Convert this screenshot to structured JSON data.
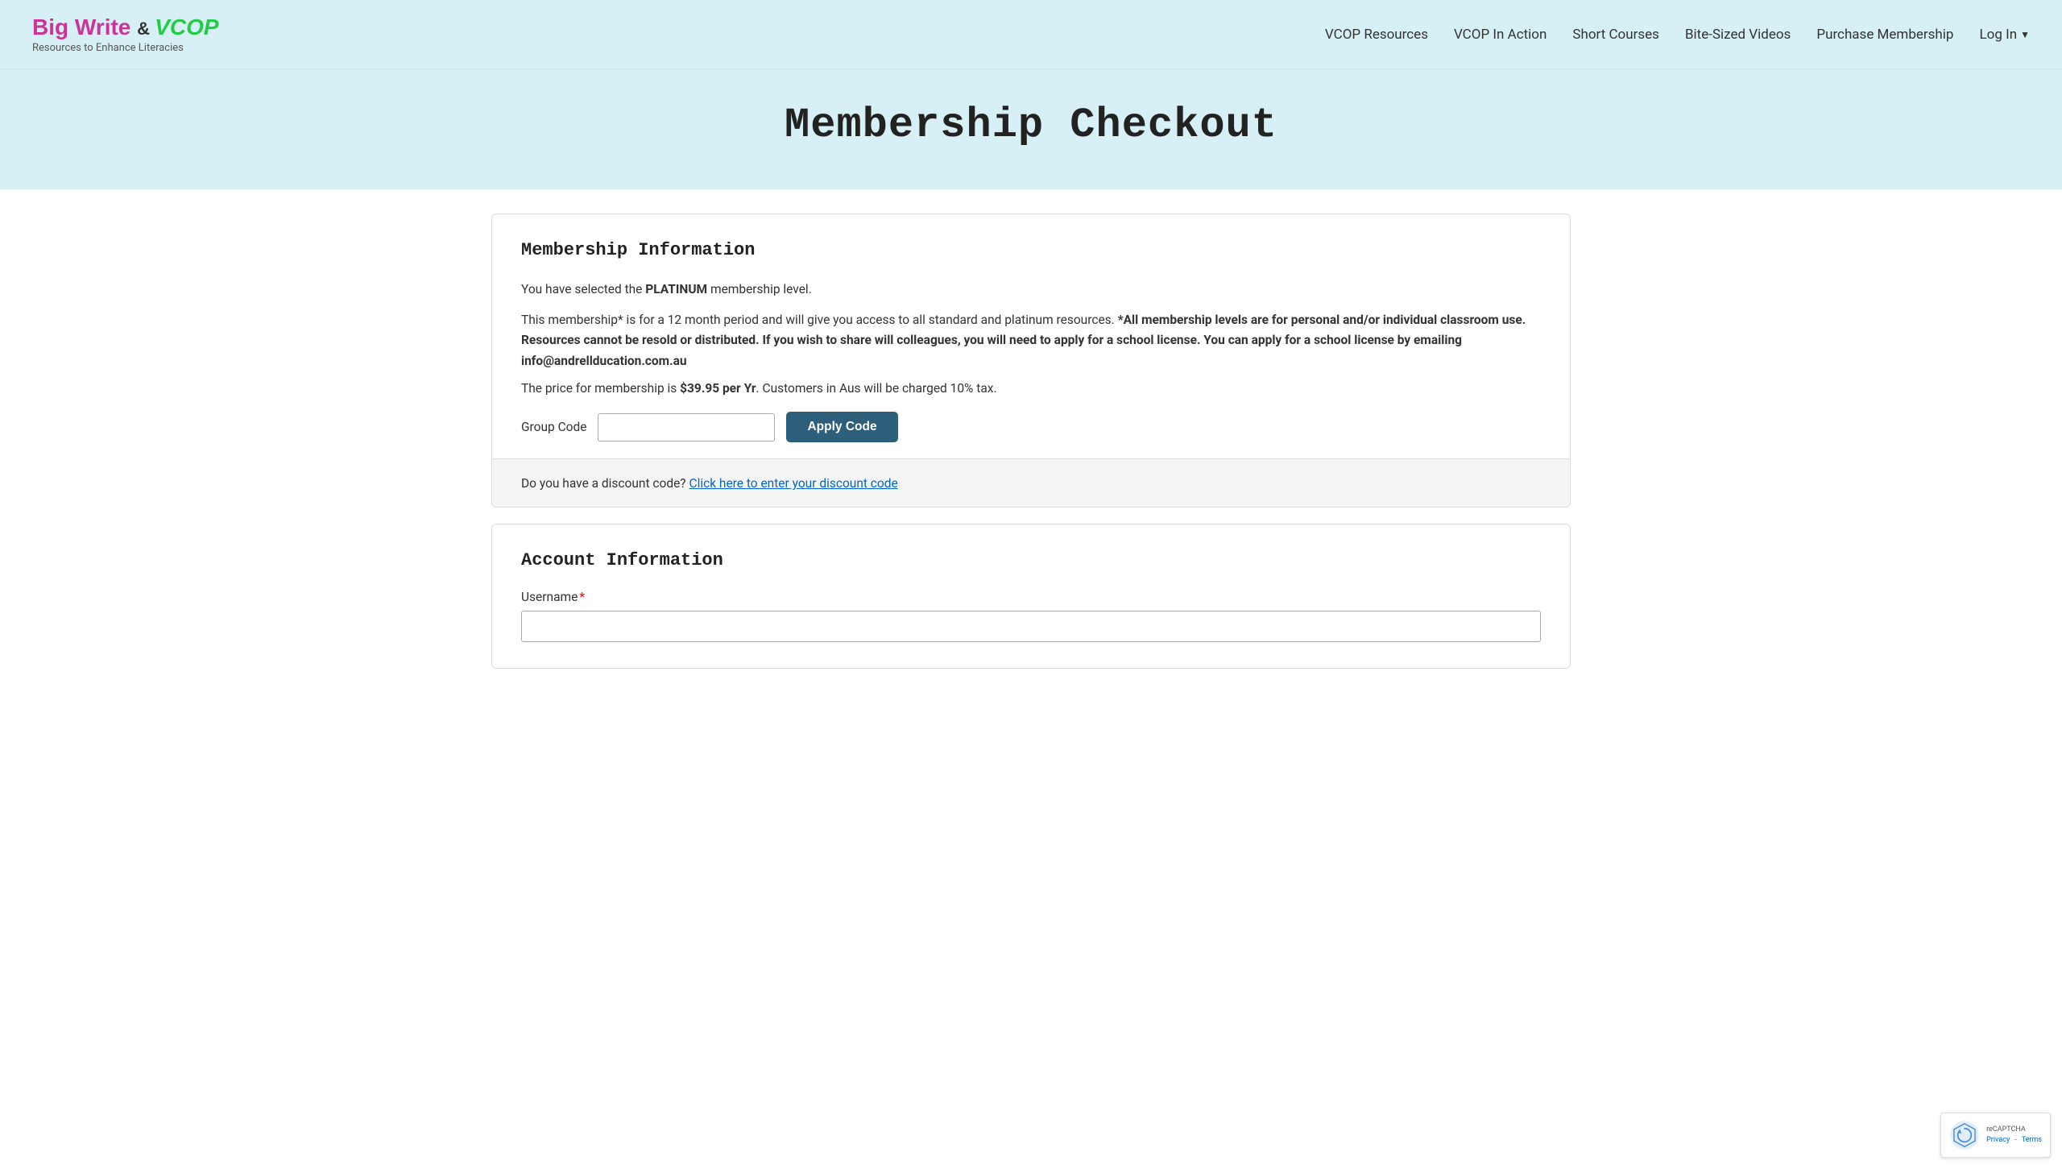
{
  "site": {
    "logo_big_write": "Big Write",
    "logo_and": " & ",
    "logo_vcop": "VCOP",
    "logo_subtitle": "Resources to Enhance Literacies"
  },
  "nav": {
    "items": [
      {
        "id": "vcop-resources",
        "label": "VCOP Resources"
      },
      {
        "id": "vcop-in-action",
        "label": "VCOP In Action"
      },
      {
        "id": "short-courses",
        "label": "Short Courses"
      },
      {
        "id": "bite-sized-videos",
        "label": "Bite-Sized Videos"
      },
      {
        "id": "purchase-membership",
        "label": "Purchase Membership"
      },
      {
        "id": "log-in",
        "label": "Log In"
      }
    ]
  },
  "page": {
    "title": "Membership Checkout"
  },
  "membership_info": {
    "section_title": "Membership Information",
    "selected_text_pre": "You have selected the ",
    "membership_level": "PLATINUM",
    "selected_text_post": " membership level.",
    "description_line1": "This membership* is for a 12 month period and will give you access to all standard and platinum resources.",
    "description_line2_bold": "*All membership levels are for personal and/or individual classroom use. Resources cannot be resold or distributed. If you wish to share will colleagues, you will need to apply for a school license. You can apply for a school license by emailing info@andrelleducation.com.au",
    "price_text_pre": "The price for membership is ",
    "price_value": "$39.95 per Yr",
    "price_text_post": ". Customers in Aus will be charged 10% tax.",
    "group_code_label": "Group Code",
    "group_code_placeholder": "",
    "apply_code_button": "Apply Code",
    "discount_text_pre": "Do you have a discount code? ",
    "discount_link": "Click here to enter your discount code"
  },
  "account_info": {
    "section_title": "Account Information",
    "username_label": "Username",
    "username_required": "*",
    "username_placeholder": ""
  },
  "recaptcha": {
    "logo_text": "reCAPTCHA",
    "privacy_label": "Privacy",
    "terms_label": "Terms"
  }
}
